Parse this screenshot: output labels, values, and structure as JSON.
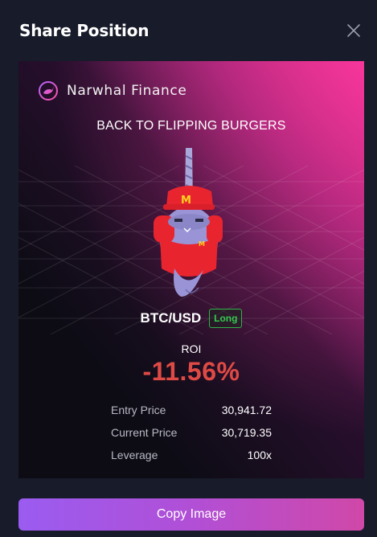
{
  "modal": {
    "title": "Share Position",
    "close_icon": "close-icon"
  },
  "card": {
    "brand": {
      "name": "Narwhal Finance",
      "logo_icon": "narwhal-logo-icon"
    },
    "headline": "BACK TO FLIPPING BURGERS",
    "mascot": "narwhal-burger-mascot",
    "pair": "BTC/USD",
    "side": "Long",
    "roi_label": "ROI",
    "roi_value": "-11.56%",
    "stats": [
      {
        "label": "Entry Price",
        "value": "30,941.72"
      },
      {
        "label": "Current Price",
        "value": "30,719.35"
      },
      {
        "label": "Leverage",
        "value": "100x"
      }
    ]
  },
  "actions": {
    "copy_label": "Copy Image"
  },
  "colors": {
    "background": "#181b2a",
    "card": "#0d0c15",
    "accent_pink": "#e8359a",
    "negative": "#e04a45",
    "long": "#35c94e",
    "button_start": "#9a5cf0",
    "button_end": "#d048a8"
  }
}
